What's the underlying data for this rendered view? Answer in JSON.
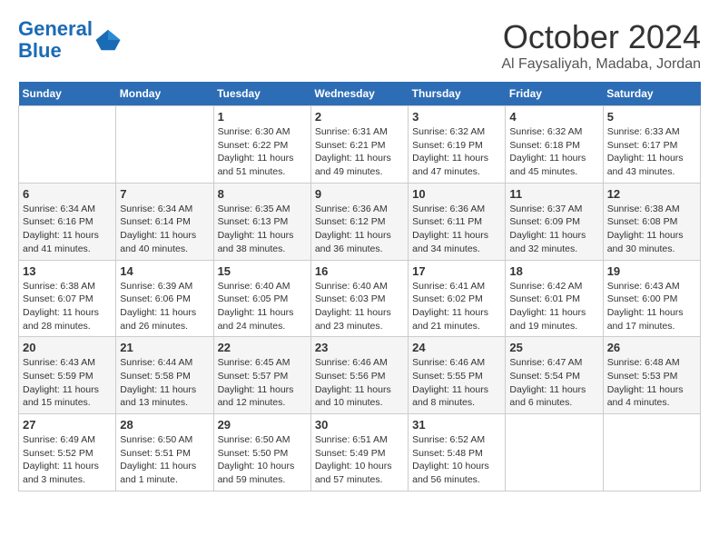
{
  "header": {
    "logo_line1": "General",
    "logo_line2": "Blue",
    "month": "October 2024",
    "location": "Al Faysaliyah, Madaba, Jordan"
  },
  "weekdays": [
    "Sunday",
    "Monday",
    "Tuesday",
    "Wednesday",
    "Thursday",
    "Friday",
    "Saturday"
  ],
  "weeks": [
    [
      {
        "day": "",
        "info": ""
      },
      {
        "day": "",
        "info": ""
      },
      {
        "day": "1",
        "info": "Sunrise: 6:30 AM\nSunset: 6:22 PM\nDaylight: 11 hours and 51 minutes."
      },
      {
        "day": "2",
        "info": "Sunrise: 6:31 AM\nSunset: 6:21 PM\nDaylight: 11 hours and 49 minutes."
      },
      {
        "day": "3",
        "info": "Sunrise: 6:32 AM\nSunset: 6:19 PM\nDaylight: 11 hours and 47 minutes."
      },
      {
        "day": "4",
        "info": "Sunrise: 6:32 AM\nSunset: 6:18 PM\nDaylight: 11 hours and 45 minutes."
      },
      {
        "day": "5",
        "info": "Sunrise: 6:33 AM\nSunset: 6:17 PM\nDaylight: 11 hours and 43 minutes."
      }
    ],
    [
      {
        "day": "6",
        "info": "Sunrise: 6:34 AM\nSunset: 6:16 PM\nDaylight: 11 hours and 41 minutes."
      },
      {
        "day": "7",
        "info": "Sunrise: 6:34 AM\nSunset: 6:14 PM\nDaylight: 11 hours and 40 minutes."
      },
      {
        "day": "8",
        "info": "Sunrise: 6:35 AM\nSunset: 6:13 PM\nDaylight: 11 hours and 38 minutes."
      },
      {
        "day": "9",
        "info": "Sunrise: 6:36 AM\nSunset: 6:12 PM\nDaylight: 11 hours and 36 minutes."
      },
      {
        "day": "10",
        "info": "Sunrise: 6:36 AM\nSunset: 6:11 PM\nDaylight: 11 hours and 34 minutes."
      },
      {
        "day": "11",
        "info": "Sunrise: 6:37 AM\nSunset: 6:09 PM\nDaylight: 11 hours and 32 minutes."
      },
      {
        "day": "12",
        "info": "Sunrise: 6:38 AM\nSunset: 6:08 PM\nDaylight: 11 hours and 30 minutes."
      }
    ],
    [
      {
        "day": "13",
        "info": "Sunrise: 6:38 AM\nSunset: 6:07 PM\nDaylight: 11 hours and 28 minutes."
      },
      {
        "day": "14",
        "info": "Sunrise: 6:39 AM\nSunset: 6:06 PM\nDaylight: 11 hours and 26 minutes."
      },
      {
        "day": "15",
        "info": "Sunrise: 6:40 AM\nSunset: 6:05 PM\nDaylight: 11 hours and 24 minutes."
      },
      {
        "day": "16",
        "info": "Sunrise: 6:40 AM\nSunset: 6:03 PM\nDaylight: 11 hours and 23 minutes."
      },
      {
        "day": "17",
        "info": "Sunrise: 6:41 AM\nSunset: 6:02 PM\nDaylight: 11 hours and 21 minutes."
      },
      {
        "day": "18",
        "info": "Sunrise: 6:42 AM\nSunset: 6:01 PM\nDaylight: 11 hours and 19 minutes."
      },
      {
        "day": "19",
        "info": "Sunrise: 6:43 AM\nSunset: 6:00 PM\nDaylight: 11 hours and 17 minutes."
      }
    ],
    [
      {
        "day": "20",
        "info": "Sunrise: 6:43 AM\nSunset: 5:59 PM\nDaylight: 11 hours and 15 minutes."
      },
      {
        "day": "21",
        "info": "Sunrise: 6:44 AM\nSunset: 5:58 PM\nDaylight: 11 hours and 13 minutes."
      },
      {
        "day": "22",
        "info": "Sunrise: 6:45 AM\nSunset: 5:57 PM\nDaylight: 11 hours and 12 minutes."
      },
      {
        "day": "23",
        "info": "Sunrise: 6:46 AM\nSunset: 5:56 PM\nDaylight: 11 hours and 10 minutes."
      },
      {
        "day": "24",
        "info": "Sunrise: 6:46 AM\nSunset: 5:55 PM\nDaylight: 11 hours and 8 minutes."
      },
      {
        "day": "25",
        "info": "Sunrise: 6:47 AM\nSunset: 5:54 PM\nDaylight: 11 hours and 6 minutes."
      },
      {
        "day": "26",
        "info": "Sunrise: 6:48 AM\nSunset: 5:53 PM\nDaylight: 11 hours and 4 minutes."
      }
    ],
    [
      {
        "day": "27",
        "info": "Sunrise: 6:49 AM\nSunset: 5:52 PM\nDaylight: 11 hours and 3 minutes."
      },
      {
        "day": "28",
        "info": "Sunrise: 6:50 AM\nSunset: 5:51 PM\nDaylight: 11 hours and 1 minute."
      },
      {
        "day": "29",
        "info": "Sunrise: 6:50 AM\nSunset: 5:50 PM\nDaylight: 10 hours and 59 minutes."
      },
      {
        "day": "30",
        "info": "Sunrise: 6:51 AM\nSunset: 5:49 PM\nDaylight: 10 hours and 57 minutes."
      },
      {
        "day": "31",
        "info": "Sunrise: 6:52 AM\nSunset: 5:48 PM\nDaylight: 10 hours and 56 minutes."
      },
      {
        "day": "",
        "info": ""
      },
      {
        "day": "",
        "info": ""
      }
    ]
  ]
}
